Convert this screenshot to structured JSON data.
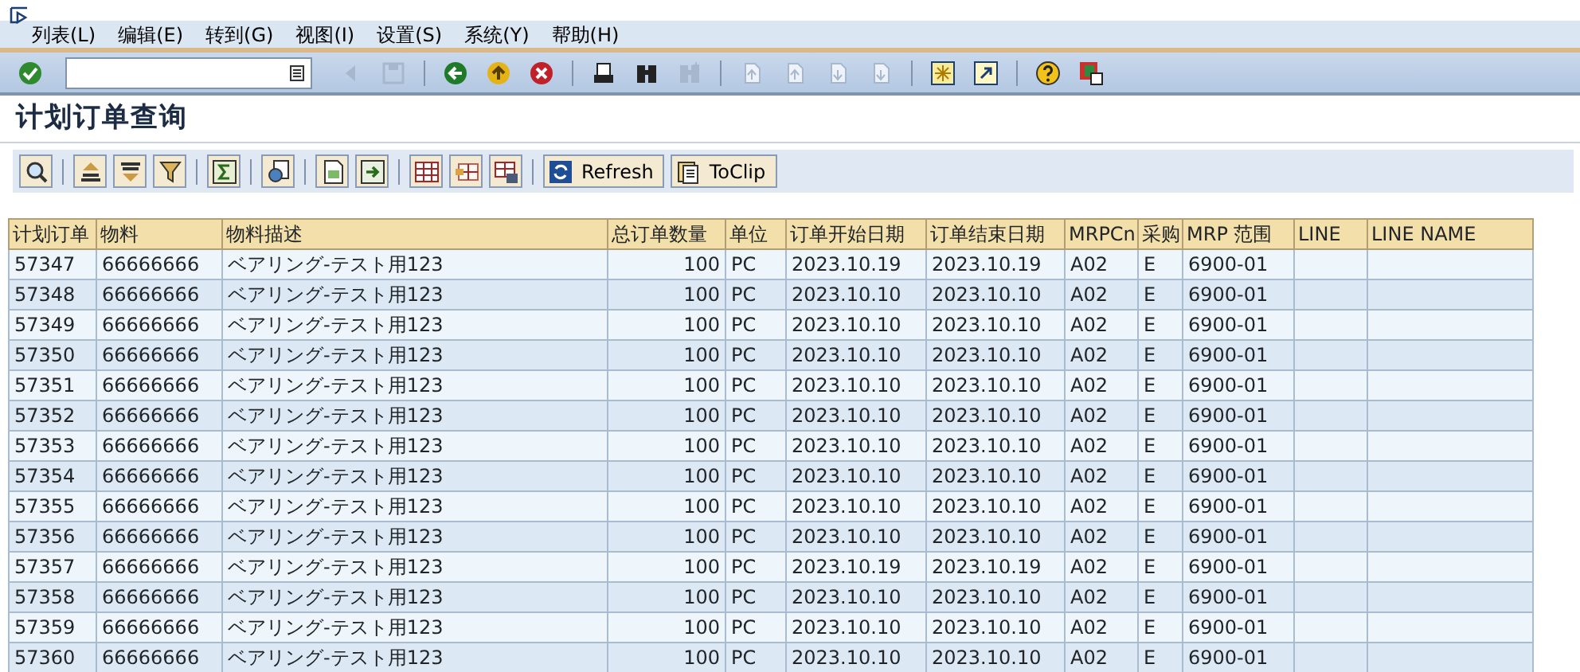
{
  "menu": [
    {
      "label": "列表(L)"
    },
    {
      "label": "编辑(E)"
    },
    {
      "label": "转到(G)"
    },
    {
      "label": "视图(I)"
    },
    {
      "label": "设置(S)"
    },
    {
      "label": "系统(Y)"
    },
    {
      "label": "帮助(H)"
    }
  ],
  "toolbar": [
    {
      "kind": "enter",
      "disabled": false
    },
    {
      "kind": "command-field"
    },
    {
      "kind": "prev",
      "disabled": true
    },
    {
      "kind": "save",
      "disabled": true
    },
    {
      "kind": "sep"
    },
    {
      "kind": "back",
      "disabled": false
    },
    {
      "kind": "exit",
      "disabled": false
    },
    {
      "kind": "cancel",
      "disabled": false
    },
    {
      "kind": "sep"
    },
    {
      "kind": "print",
      "disabled": false
    },
    {
      "kind": "find",
      "disabled": false
    },
    {
      "kind": "find-next",
      "disabled": true
    },
    {
      "kind": "sep"
    },
    {
      "kind": "first-page",
      "disabled": true
    },
    {
      "kind": "prev-page",
      "disabled": true
    },
    {
      "kind": "next-page",
      "disabled": true
    },
    {
      "kind": "last-page",
      "disabled": true
    },
    {
      "kind": "sep"
    },
    {
      "kind": "new-session",
      "disabled": false
    },
    {
      "kind": "shortcut",
      "disabled": false
    },
    {
      "kind": "sep"
    },
    {
      "kind": "help",
      "disabled": false
    },
    {
      "kind": "layout",
      "disabled": false
    }
  ],
  "title": "计划订单查询",
  "app_toolbar": [
    {
      "kind": "details"
    },
    {
      "kind": "sep"
    },
    {
      "kind": "sort-asc"
    },
    {
      "kind": "sort-desc"
    },
    {
      "kind": "filter"
    },
    {
      "kind": "sep"
    },
    {
      "kind": "sum"
    },
    {
      "kind": "sep"
    },
    {
      "kind": "views"
    },
    {
      "kind": "sep"
    },
    {
      "kind": "export"
    },
    {
      "kind": "import"
    },
    {
      "kind": "sep"
    },
    {
      "kind": "grid"
    },
    {
      "kind": "grid-change"
    },
    {
      "kind": "grid-save"
    },
    {
      "kind": "sep"
    },
    {
      "kind": "refresh",
      "label": "Refresh"
    },
    {
      "kind": "clip",
      "label": "ToClip"
    }
  ],
  "table": {
    "columns": [
      {
        "label": "计划订单",
        "kind": "text"
      },
      {
        "label": "物料",
        "kind": "text"
      },
      {
        "label": "物料描述",
        "kind": "text"
      },
      {
        "label": "总订单数量",
        "kind": "number"
      },
      {
        "label": "单位",
        "kind": "text"
      },
      {
        "label": "订单开始日期",
        "kind": "text"
      },
      {
        "label": "订单结束日期",
        "kind": "text"
      },
      {
        "label": "MRPCn",
        "kind": "text"
      },
      {
        "label": "采购",
        "kind": "text"
      },
      {
        "label": "MRP 范围",
        "kind": "text"
      },
      {
        "label": "LINE",
        "kind": "text"
      },
      {
        "label": "LINE NAME",
        "kind": "text"
      }
    ],
    "rows": [
      [
        "57347",
        "66666666",
        "ベアリング-テスト用123",
        "100",
        "PC",
        "2023.10.19",
        "2023.10.19",
        "A02",
        "E",
        "6900-01",
        "",
        ""
      ],
      [
        "57348",
        "66666666",
        "ベアリング-テスト用123",
        "100",
        "PC",
        "2023.10.10",
        "2023.10.10",
        "A02",
        "E",
        "6900-01",
        "",
        ""
      ],
      [
        "57349",
        "66666666",
        "ベアリング-テスト用123",
        "100",
        "PC",
        "2023.10.10",
        "2023.10.10",
        "A02",
        "E",
        "6900-01",
        "",
        ""
      ],
      [
        "57350",
        "66666666",
        "ベアリング-テスト用123",
        "100",
        "PC",
        "2023.10.10",
        "2023.10.10",
        "A02",
        "E",
        "6900-01",
        "",
        ""
      ],
      [
        "57351",
        "66666666",
        "ベアリング-テスト用123",
        "100",
        "PC",
        "2023.10.10",
        "2023.10.10",
        "A02",
        "E",
        "6900-01",
        "",
        ""
      ],
      [
        "57352",
        "66666666",
        "ベアリング-テスト用123",
        "100",
        "PC",
        "2023.10.10",
        "2023.10.10",
        "A02",
        "E",
        "6900-01",
        "",
        ""
      ],
      [
        "57353",
        "66666666",
        "ベアリング-テスト用123",
        "100",
        "PC",
        "2023.10.10",
        "2023.10.10",
        "A02",
        "E",
        "6900-01",
        "",
        ""
      ],
      [
        "57354",
        "66666666",
        "ベアリング-テスト用123",
        "100",
        "PC",
        "2023.10.10",
        "2023.10.10",
        "A02",
        "E",
        "6900-01",
        "",
        ""
      ],
      [
        "57355",
        "66666666",
        "ベアリング-テスト用123",
        "100",
        "PC",
        "2023.10.10",
        "2023.10.10",
        "A02",
        "E",
        "6900-01",
        "",
        ""
      ],
      [
        "57356",
        "66666666",
        "ベアリング-テスト用123",
        "100",
        "PC",
        "2023.10.10",
        "2023.10.10",
        "A02",
        "E",
        "6900-01",
        "",
        ""
      ],
      [
        "57357",
        "66666666",
        "ベアリング-テスト用123",
        "100",
        "PC",
        "2023.10.19",
        "2023.10.19",
        "A02",
        "E",
        "6900-01",
        "",
        ""
      ],
      [
        "57358",
        "66666666",
        "ベアリング-テスト用123",
        "100",
        "PC",
        "2023.10.10",
        "2023.10.10",
        "A02",
        "E",
        "6900-01",
        "",
        ""
      ],
      [
        "57359",
        "66666666",
        "ベアリング-テスト用123",
        "100",
        "PC",
        "2023.10.10",
        "2023.10.10",
        "A02",
        "E",
        "6900-01",
        "",
        ""
      ],
      [
        "57360",
        "66666666",
        "ベアリング-テスト用123",
        "100",
        "PC",
        "2023.10.10",
        "2023.10.10",
        "A02",
        "E",
        "6900-01",
        "",
        ""
      ]
    ]
  }
}
